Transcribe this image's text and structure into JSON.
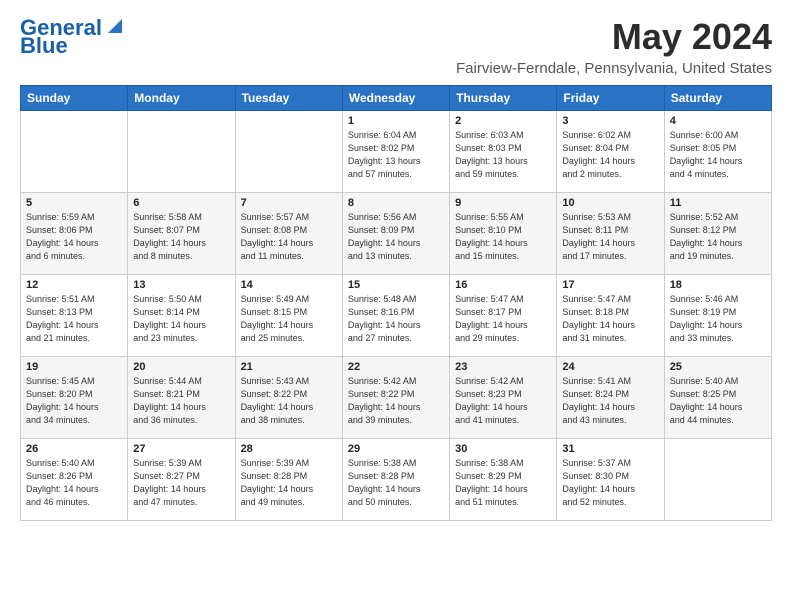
{
  "logo": {
    "line1": "General",
    "line2": "Blue"
  },
  "title": "May 2024",
  "subtitle": "Fairview-Ferndale, Pennsylvania, United States",
  "days_of_week": [
    "Sunday",
    "Monday",
    "Tuesday",
    "Wednesday",
    "Thursday",
    "Friday",
    "Saturday"
  ],
  "weeks": [
    [
      {
        "day": "",
        "info": ""
      },
      {
        "day": "",
        "info": ""
      },
      {
        "day": "",
        "info": ""
      },
      {
        "day": "1",
        "info": "Sunrise: 6:04 AM\nSunset: 8:02 PM\nDaylight: 13 hours\nand 57 minutes."
      },
      {
        "day": "2",
        "info": "Sunrise: 6:03 AM\nSunset: 8:03 PM\nDaylight: 13 hours\nand 59 minutes."
      },
      {
        "day": "3",
        "info": "Sunrise: 6:02 AM\nSunset: 8:04 PM\nDaylight: 14 hours\nand 2 minutes."
      },
      {
        "day": "4",
        "info": "Sunrise: 6:00 AM\nSunset: 8:05 PM\nDaylight: 14 hours\nand 4 minutes."
      }
    ],
    [
      {
        "day": "5",
        "info": "Sunrise: 5:59 AM\nSunset: 8:06 PM\nDaylight: 14 hours\nand 6 minutes."
      },
      {
        "day": "6",
        "info": "Sunrise: 5:58 AM\nSunset: 8:07 PM\nDaylight: 14 hours\nand 8 minutes."
      },
      {
        "day": "7",
        "info": "Sunrise: 5:57 AM\nSunset: 8:08 PM\nDaylight: 14 hours\nand 11 minutes."
      },
      {
        "day": "8",
        "info": "Sunrise: 5:56 AM\nSunset: 8:09 PM\nDaylight: 14 hours\nand 13 minutes."
      },
      {
        "day": "9",
        "info": "Sunrise: 5:55 AM\nSunset: 8:10 PM\nDaylight: 14 hours\nand 15 minutes."
      },
      {
        "day": "10",
        "info": "Sunrise: 5:53 AM\nSunset: 8:11 PM\nDaylight: 14 hours\nand 17 minutes."
      },
      {
        "day": "11",
        "info": "Sunrise: 5:52 AM\nSunset: 8:12 PM\nDaylight: 14 hours\nand 19 minutes."
      }
    ],
    [
      {
        "day": "12",
        "info": "Sunrise: 5:51 AM\nSunset: 8:13 PM\nDaylight: 14 hours\nand 21 minutes."
      },
      {
        "day": "13",
        "info": "Sunrise: 5:50 AM\nSunset: 8:14 PM\nDaylight: 14 hours\nand 23 minutes."
      },
      {
        "day": "14",
        "info": "Sunrise: 5:49 AM\nSunset: 8:15 PM\nDaylight: 14 hours\nand 25 minutes."
      },
      {
        "day": "15",
        "info": "Sunrise: 5:48 AM\nSunset: 8:16 PM\nDaylight: 14 hours\nand 27 minutes."
      },
      {
        "day": "16",
        "info": "Sunrise: 5:47 AM\nSunset: 8:17 PM\nDaylight: 14 hours\nand 29 minutes."
      },
      {
        "day": "17",
        "info": "Sunrise: 5:47 AM\nSunset: 8:18 PM\nDaylight: 14 hours\nand 31 minutes."
      },
      {
        "day": "18",
        "info": "Sunrise: 5:46 AM\nSunset: 8:19 PM\nDaylight: 14 hours\nand 33 minutes."
      }
    ],
    [
      {
        "day": "19",
        "info": "Sunrise: 5:45 AM\nSunset: 8:20 PM\nDaylight: 14 hours\nand 34 minutes."
      },
      {
        "day": "20",
        "info": "Sunrise: 5:44 AM\nSunset: 8:21 PM\nDaylight: 14 hours\nand 36 minutes."
      },
      {
        "day": "21",
        "info": "Sunrise: 5:43 AM\nSunset: 8:22 PM\nDaylight: 14 hours\nand 38 minutes."
      },
      {
        "day": "22",
        "info": "Sunrise: 5:42 AM\nSunset: 8:22 PM\nDaylight: 14 hours\nand 39 minutes."
      },
      {
        "day": "23",
        "info": "Sunrise: 5:42 AM\nSunset: 8:23 PM\nDaylight: 14 hours\nand 41 minutes."
      },
      {
        "day": "24",
        "info": "Sunrise: 5:41 AM\nSunset: 8:24 PM\nDaylight: 14 hours\nand 43 minutes."
      },
      {
        "day": "25",
        "info": "Sunrise: 5:40 AM\nSunset: 8:25 PM\nDaylight: 14 hours\nand 44 minutes."
      }
    ],
    [
      {
        "day": "26",
        "info": "Sunrise: 5:40 AM\nSunset: 8:26 PM\nDaylight: 14 hours\nand 46 minutes."
      },
      {
        "day": "27",
        "info": "Sunrise: 5:39 AM\nSunset: 8:27 PM\nDaylight: 14 hours\nand 47 minutes."
      },
      {
        "day": "28",
        "info": "Sunrise: 5:39 AM\nSunset: 8:28 PM\nDaylight: 14 hours\nand 49 minutes."
      },
      {
        "day": "29",
        "info": "Sunrise: 5:38 AM\nSunset: 8:28 PM\nDaylight: 14 hours\nand 50 minutes."
      },
      {
        "day": "30",
        "info": "Sunrise: 5:38 AM\nSunset: 8:29 PM\nDaylight: 14 hours\nand 51 minutes."
      },
      {
        "day": "31",
        "info": "Sunrise: 5:37 AM\nSunset: 8:30 PM\nDaylight: 14 hours\nand 52 minutes."
      },
      {
        "day": "",
        "info": ""
      }
    ]
  ]
}
